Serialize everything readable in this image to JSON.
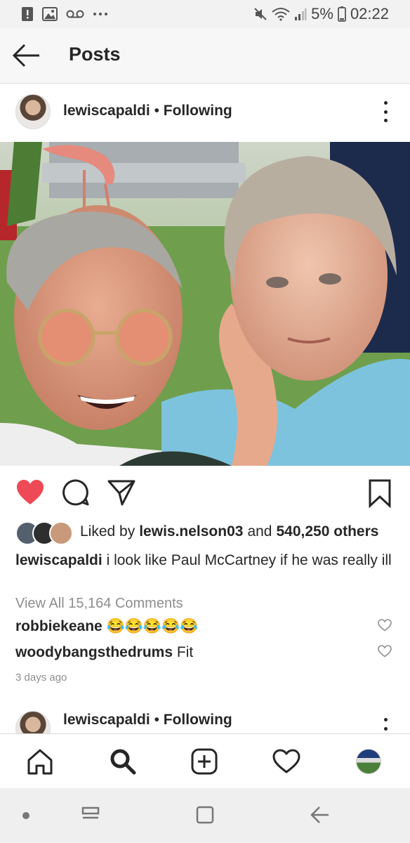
{
  "status_bar": {
    "battery": "5%",
    "time": "02:22",
    "left_icons": [
      "alert-icon",
      "image-icon",
      "voicemail-icon",
      "more-dots-icon"
    ],
    "right_icons": [
      "mute-icon",
      "wifi-icon",
      "signal-icon",
      "battery-icon"
    ]
  },
  "header": {
    "title": "Posts"
  },
  "post": {
    "username": "lewiscapaldi",
    "separator": "•",
    "follow_status": "Following",
    "likes": {
      "prefix": "Liked by",
      "user": "lewis.nelson03",
      "joiner": "and",
      "count": "540,250 others"
    },
    "caption": {
      "user": "lewiscapaldi",
      "text": "i look like Paul McCartney if he was really ill"
    },
    "view_all": "View All 15,164 Comments",
    "comments": [
      {
        "user": "robbiekeane",
        "text": "😂😂😂😂😂"
      },
      {
        "user": "woodybangsthedrums",
        "text": "Fit"
      }
    ],
    "timestamp": "3 days ago",
    "liked": true,
    "colors": {
      "like_red": "#ed4956",
      "text": "#262626",
      "muted": "#8e8e8e"
    }
  },
  "next_post": {
    "username": "lewiscapaldi",
    "separator": "•",
    "follow_status": "Following"
  },
  "bottom_nav": [
    "home-icon",
    "search-icon",
    "add-post-icon",
    "activity-heart-icon",
    "profile-avatar"
  ],
  "system_nav": [
    "dot-icon",
    "recent-apps-icon",
    "home-square-icon",
    "back-arrow-icon"
  ]
}
